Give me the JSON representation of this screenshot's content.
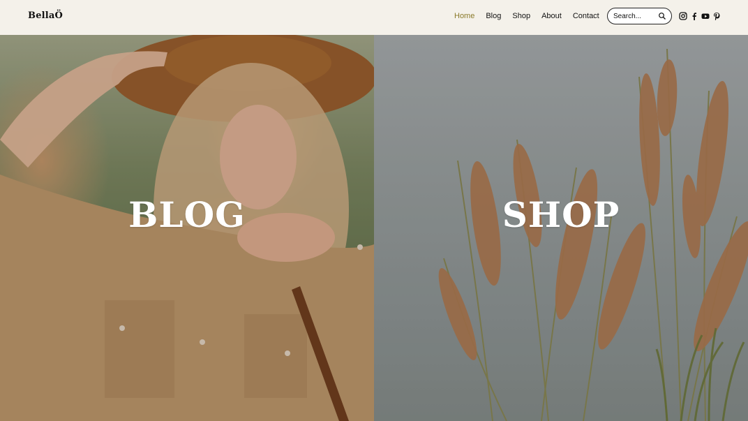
{
  "brand": {
    "logo": "BellaÖ",
    "accent_color": "#8a7a2a"
  },
  "nav": {
    "items": [
      {
        "label": "Home",
        "active": true
      },
      {
        "label": "Blog",
        "active": false
      },
      {
        "label": "Shop",
        "active": false
      },
      {
        "label": "About",
        "active": false
      },
      {
        "label": "Contact",
        "active": false
      }
    ]
  },
  "search": {
    "placeholder": "Search...",
    "icon": "search-icon"
  },
  "social": [
    "instagram-icon",
    "facebook-icon",
    "youtube-icon",
    "pinterest-icon"
  ],
  "panels": {
    "blog": {
      "title": "BLOG",
      "image": "woman-in-straw-hat-photo"
    },
    "shop": {
      "title": "SHOP",
      "image": "pampas-grass-photo"
    }
  }
}
